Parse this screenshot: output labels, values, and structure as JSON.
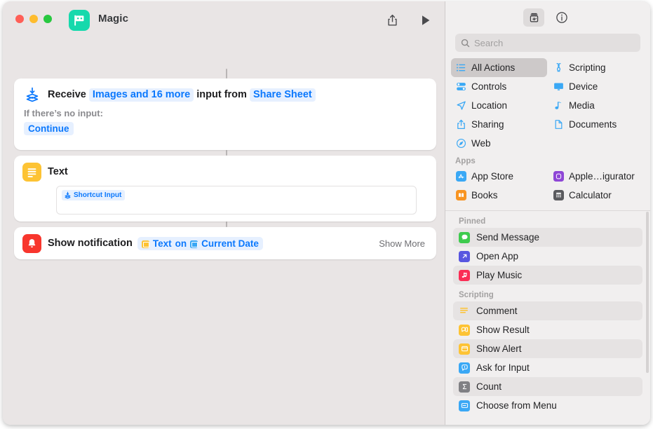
{
  "window": {
    "title": "Magic",
    "app_icon": "shortcuts-magic-icon",
    "accent": "#0b78fd",
    "canvas_bg": "#e9e5e5",
    "panel_bg": "#f1efef"
  },
  "titlebar": {
    "share_label": "share-icon",
    "run_label": "run-icon"
  },
  "workflow": {
    "receive": {
      "verb": "Receive",
      "input_types": "Images and 16 more",
      "middle": "input from",
      "source": "Share Sheet",
      "no_input_label": "If there’s no input:",
      "no_input_value": "Continue"
    },
    "text": {
      "title": "Text",
      "token": "Shortcut Input",
      "field_value": ""
    },
    "notify": {
      "title": "Show notification",
      "token_1": "Text",
      "joiner": "on",
      "token_2": "Current Date",
      "show_more": "Show More"
    }
  },
  "panel": {
    "toolbar": {
      "library_button": "action-library-icon",
      "info_button": "info-icon"
    },
    "search": {
      "placeholder": "Search",
      "value": ""
    },
    "categories": [
      {
        "label": "All Actions",
        "icon": "list-icon",
        "color": "#3aa8f5",
        "selected": true
      },
      {
        "label": "Scripting",
        "icon": "scripting-icon",
        "color": "#3aa8f5",
        "selected": false
      },
      {
        "label": "Controls",
        "icon": "controls-icon",
        "color": "#3aa8f5",
        "selected": false
      },
      {
        "label": "Device",
        "icon": "device-icon",
        "color": "#3aa8f5",
        "selected": false
      },
      {
        "label": "Location",
        "icon": "location-icon",
        "color": "#3aa8f5",
        "selected": false
      },
      {
        "label": "Media",
        "icon": "media-icon",
        "color": "#3aa8f5",
        "selected": false
      },
      {
        "label": "Sharing",
        "icon": "sharing-icon",
        "color": "#3aa8f5",
        "selected": false
      },
      {
        "label": "Documents",
        "icon": "documents-icon",
        "color": "#3aa8f5",
        "selected": false
      },
      {
        "label": "Web",
        "icon": "web-icon",
        "color": "#3aa8f5",
        "selected": false
      }
    ],
    "apps_header": "Apps",
    "apps": [
      {
        "label": "App Store",
        "color": "#3aa8f5"
      },
      {
        "label": "Apple…igurator",
        "color": "#8e46d6"
      },
      {
        "label": "Books",
        "color": "#f89422"
      },
      {
        "label": "Calculator",
        "color": "#5a5a5e"
      }
    ],
    "pinned_header": "Pinned",
    "pinned": [
      {
        "label": "Send Message",
        "icon": "message-icon",
        "color": "#3ecb4e"
      },
      {
        "label": "Open App",
        "icon": "open-app-icon",
        "color": "#5856e0"
      },
      {
        "label": "Play Music",
        "icon": "music-icon",
        "color": "#fb2d55"
      }
    ],
    "scripting_header": "Scripting",
    "scripting": [
      {
        "label": "Comment",
        "icon": "comment-icon",
        "color": "#fdc334"
      },
      {
        "label": "Show Result",
        "icon": "show-result-icon",
        "color": "#fdc334"
      },
      {
        "label": "Show Alert",
        "icon": "show-alert-icon",
        "color": "#fdc334"
      },
      {
        "label": "Ask for Input",
        "icon": "ask-input-icon",
        "color": "#3aa8f5"
      },
      {
        "label": "Count",
        "icon": "count-icon",
        "color": "#808084"
      },
      {
        "label": "Choose from Menu",
        "icon": "menu-icon",
        "color": "#3aa8f5"
      }
    ]
  }
}
